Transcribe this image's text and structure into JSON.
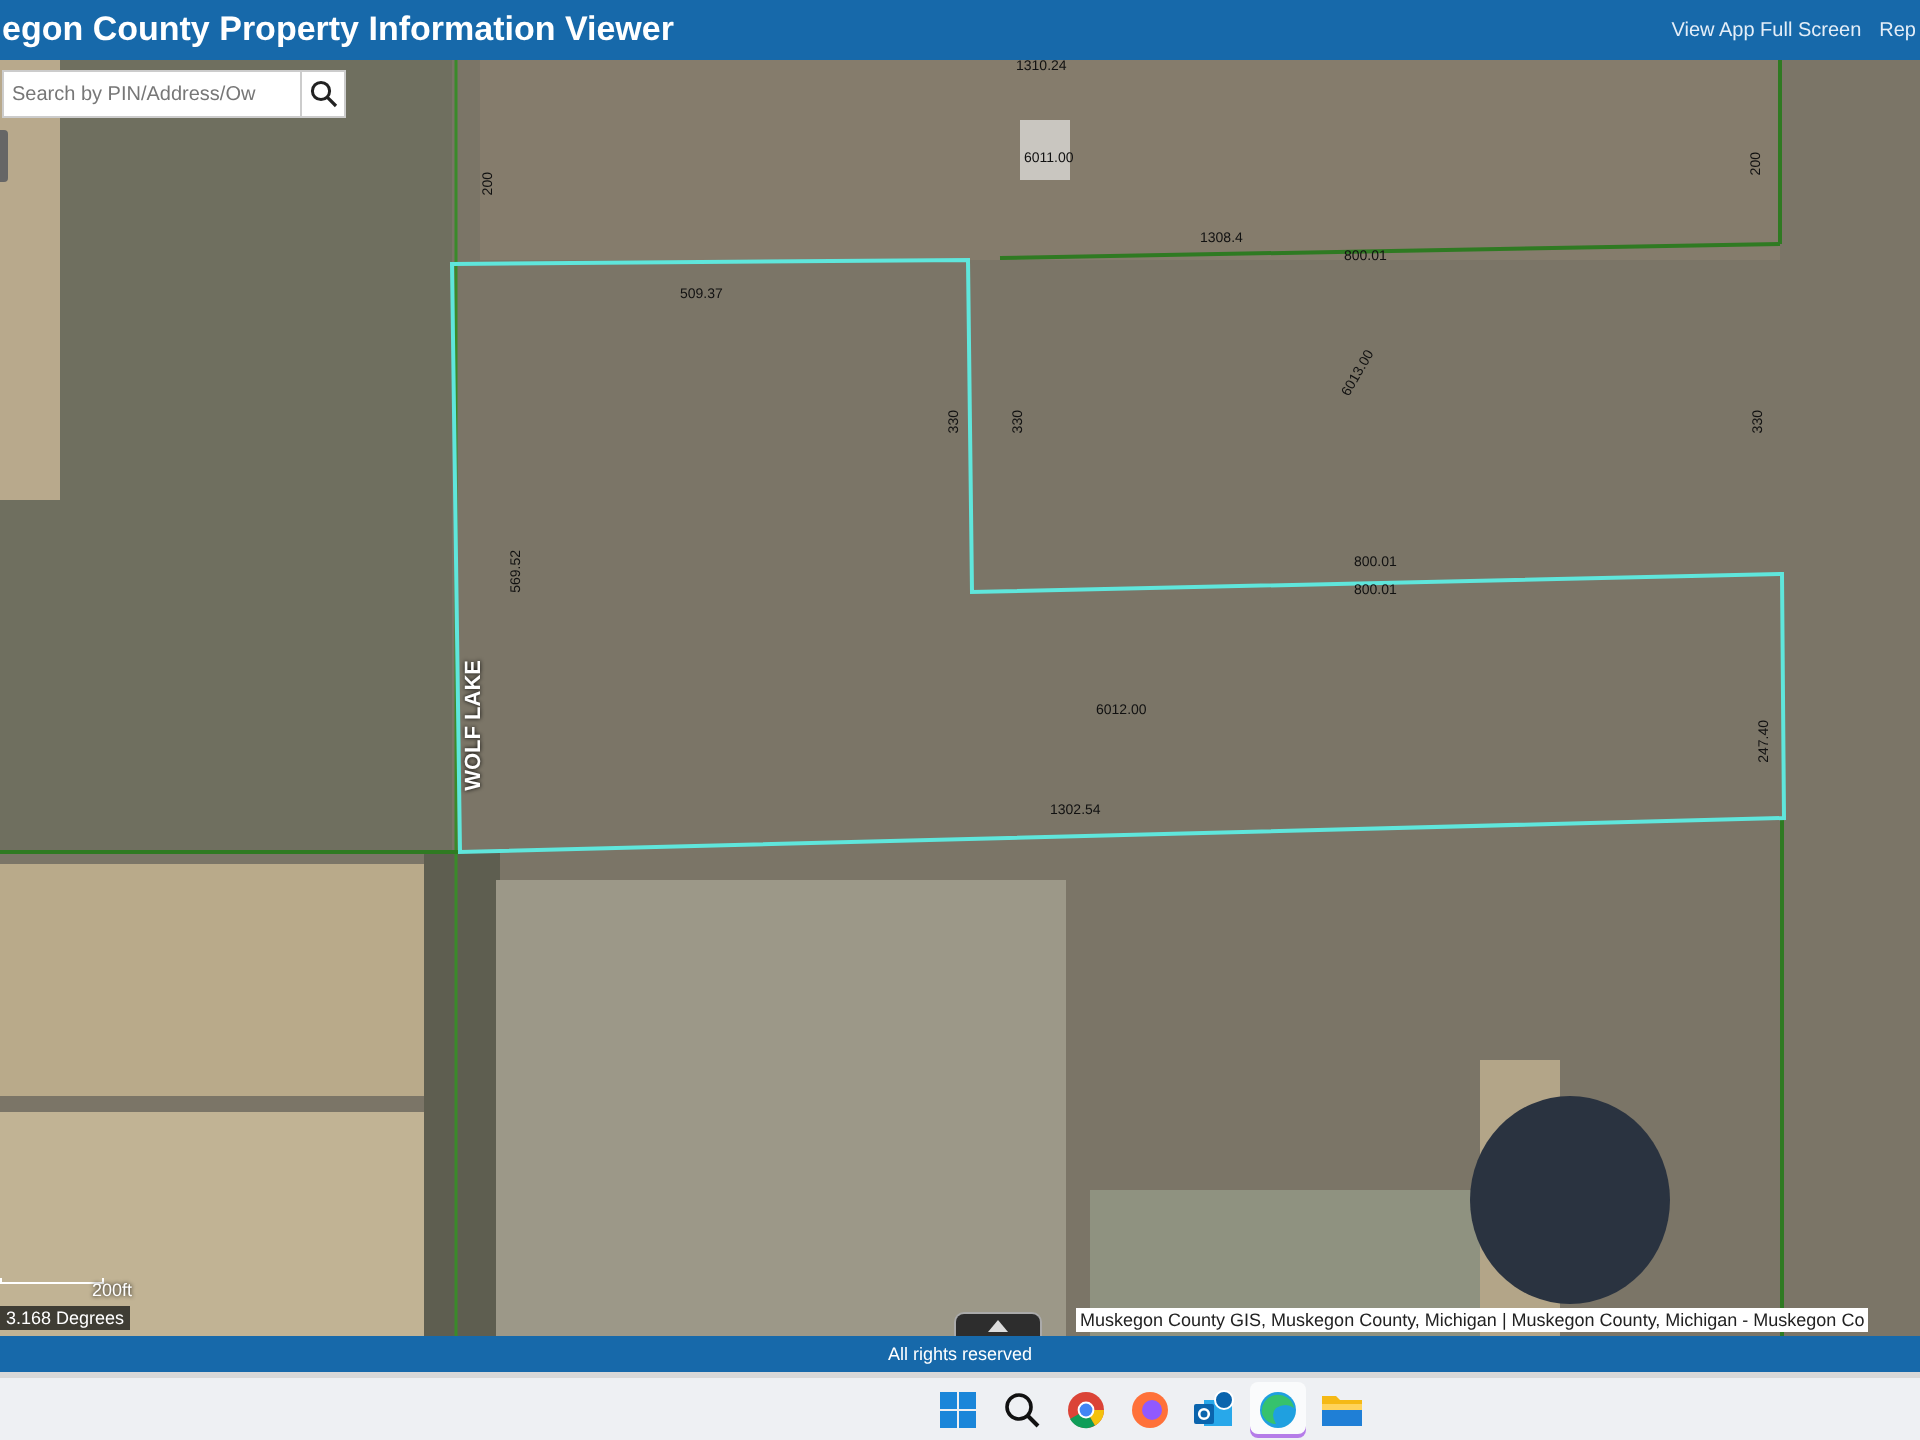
{
  "header": {
    "title": "egon County Property Information Viewer",
    "links": [
      "View App Full Screen",
      "Rep"
    ]
  },
  "search": {
    "placeholder": "Search by PIN/Address/Ow"
  },
  "map": {
    "labels": [
      {
        "text": "1310.24",
        "kind": "horizontal"
      },
      {
        "text": "6011.00",
        "kind": "horizontal"
      },
      {
        "text": "200",
        "kind": "vertical"
      },
      {
        "text": "200",
        "kind": "vertical"
      },
      {
        "text": "1308.4",
        "kind": "horizontal"
      },
      {
        "text": "800.01",
        "kind": "horizontal"
      },
      {
        "text": "509.37",
        "kind": "horizontal"
      },
      {
        "text": "330",
        "kind": "vertical"
      },
      {
        "text": "330",
        "kind": "vertical"
      },
      {
        "text": "6013.00",
        "kind": "diagonal"
      },
      {
        "text": "330",
        "kind": "vertical"
      },
      {
        "text": "569.52",
        "kind": "vertical"
      },
      {
        "text": "WOLF LAKE",
        "kind": "road"
      },
      {
        "text": "800.01",
        "kind": "horizontal"
      },
      {
        "text": "800.01",
        "kind": "horizontal"
      },
      {
        "text": "6012.00",
        "kind": "horizontal"
      },
      {
        "text": "247.40",
        "kind": "vertical"
      },
      {
        "text": "1302.54",
        "kind": "horizontal"
      }
    ],
    "scale": "200ft",
    "coordinates": "3.168 Degrees",
    "attribution": "Muskegon County GIS, Muskegon County, Michigan | Muskegon County, Michigan - Muskegon Co"
  },
  "footer": {
    "text": "All rights reserved"
  },
  "taskbar": {
    "apps": [
      {
        "kind": "windows",
        "selected": false
      },
      {
        "kind": "search",
        "selected": false
      },
      {
        "kind": "chrome",
        "selected": false
      },
      {
        "kind": "firefox",
        "selected": false
      },
      {
        "kind": "outlook",
        "selected": false
      },
      {
        "kind": "edge",
        "selected": true
      },
      {
        "kind": "folder",
        "selected": false
      }
    ]
  }
}
